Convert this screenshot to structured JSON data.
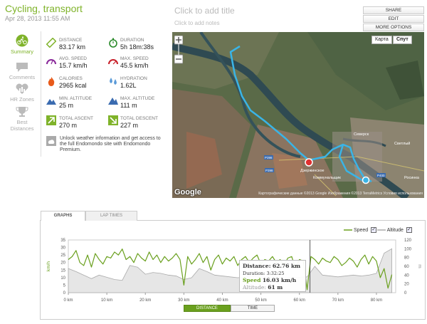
{
  "workout": {
    "title": "Cycling, transport",
    "date": "Apr 28, 2013 11:55 AM",
    "click_title": "Click to add title",
    "click_notes": "Click to add notes"
  },
  "actions": {
    "share": "SHARE",
    "edit": "EDIT",
    "more": "MORE OPTIONS"
  },
  "nav": {
    "summary": "Summary",
    "comments": "Comments",
    "hr_zones": "HR Zones",
    "best_line1": "Best",
    "best_line2": "Distances"
  },
  "stats": {
    "distance": {
      "label": "DISTANCE",
      "value": "83.17 km"
    },
    "duration": {
      "label": "DURATION",
      "value": "5h 18m:38s"
    },
    "avg_speed": {
      "label": "AVG. SPEED",
      "value": "15.7 km/h"
    },
    "max_speed": {
      "label": "MAX. SPEED",
      "value": "45.5 km/h"
    },
    "calories": {
      "label": "CALORIES",
      "value": "2965 kcal"
    },
    "hydration": {
      "label": "HYDRATION",
      "value": "1.62L"
    },
    "min_altitude": {
      "label": "MIN. ALTITUDE",
      "value": "25 m"
    },
    "max_altitude": {
      "label": "MAX. ALTITUDE",
      "value": "111 m"
    },
    "total_ascent": {
      "label": "TOTAL ASCENT",
      "value": "270 m"
    },
    "total_descent": {
      "label": "TOTAL DESCENT",
      "value": "227 m"
    }
  },
  "notice": "Unlock weather information and get access to the full Endomondo site with Endomondo Premium.",
  "map": {
    "map_btn": "Карта",
    "sat_btn": "Спут",
    "google": "Google",
    "attribution": "Картографические данные ©2013 Google Изображения ©2013 TerraMetrics Условия использования",
    "places": [
      "Дзержинское",
      "Коммунальщик",
      "Северск",
      "Светлый",
      "Росинка",
      "P398",
      "P400",
      "P398"
    ]
  },
  "graph_tabs": {
    "graphs": "GRAPHS",
    "lap_times": "LAP TIMES"
  },
  "legend": {
    "speed": "Speed",
    "altitude": "Altitude"
  },
  "toggle": {
    "distance": "DISTANCE",
    "time": "TIME"
  },
  "tooltip": {
    "distance_label": "Distance:",
    "distance_value": "62.76 km",
    "duration_label": "Duration:",
    "duration_value": "3:32:25",
    "speed_label": "Speed",
    "speed_value": "16.03 km/h",
    "altitude_label": "Altitude:",
    "altitude_value": "61 m"
  },
  "colors": {
    "accent": "#7fb32a",
    "speed": "#6aa01e",
    "altitude": "#aaaaaa",
    "route": "#3ab4e6"
  },
  "chart_data": {
    "type": "line",
    "ylabel_left": "km/h",
    "ylabel_right": "m",
    "xlim": [
      0,
      85
    ],
    "ylim_speed": [
      0,
      35
    ],
    "ylim_alt": [
      0,
      120
    ],
    "x_ticks": [
      "0 km",
      "10 km",
      "20 km",
      "30 km",
      "40 km",
      "50 km",
      "60 km",
      "70 km",
      "80 km"
    ],
    "y_ticks_left": [
      "0",
      "5",
      "10",
      "15",
      "20",
      "25",
      "30",
      "35"
    ],
    "y_ticks_right": [
      "0",
      "20",
      "40",
      "60",
      "80",
      "100",
      "120"
    ],
    "series": [
      {
        "name": "Speed",
        "x": [
          0,
          1,
          2,
          3,
          4,
          5,
          6,
          7,
          8,
          9,
          10,
          11,
          12,
          13,
          14,
          15,
          16,
          17,
          18,
          19,
          20,
          21,
          22,
          23,
          24,
          25,
          26,
          27,
          28,
          29,
          30,
          31,
          32,
          33,
          34,
          35,
          36,
          37,
          38,
          39,
          40,
          41,
          42,
          43,
          44,
          45,
          46,
          47,
          48,
          49,
          50,
          51,
          52,
          53,
          54,
          55,
          56,
          57,
          58,
          59,
          60,
          61,
          62,
          63,
          64,
          65,
          66,
          67,
          68,
          69,
          70,
          71,
          72,
          73,
          74,
          75,
          76,
          77,
          78,
          79,
          80,
          81,
          82,
          83,
          84
        ],
        "values": [
          22,
          24,
          28,
          20,
          18,
          25,
          17,
          26,
          22,
          19,
          24,
          23,
          27,
          25,
          29,
          22,
          24,
          20,
          26,
          23,
          21,
          27,
          22,
          25,
          20,
          24,
          21,
          23,
          26,
          22,
          5,
          24,
          19,
          22,
          26,
          20,
          24,
          15,
          22,
          25,
          19,
          23,
          21,
          24,
          18,
          22,
          24,
          20,
          23,
          25,
          19,
          22,
          21,
          24,
          20,
          22,
          18,
          23,
          24,
          16,
          22,
          21,
          2,
          24,
          22,
          19,
          23,
          21,
          20,
          24,
          22,
          18,
          20,
          23,
          21,
          17,
          22,
          25,
          19,
          24,
          21,
          10,
          16,
          3,
          12
        ]
      },
      {
        "name": "Altitude",
        "x": [
          0,
          2,
          4,
          6,
          8,
          10,
          12,
          14,
          16,
          18,
          20,
          22,
          24,
          26,
          28,
          30,
          32,
          34,
          36,
          38,
          40,
          42,
          44,
          46,
          48,
          50,
          52,
          54,
          56,
          58,
          60,
          62,
          64,
          66,
          68,
          70,
          72,
          74,
          76,
          78,
          80,
          82,
          84
        ],
        "values": [
          55,
          48,
          40,
          32,
          40,
          35,
          30,
          28,
          62,
          58,
          42,
          46,
          44,
          40,
          38,
          30,
          34,
          55,
          48,
          40,
          38,
          36,
          34,
          36,
          38,
          36,
          35,
          34,
          33,
          34,
          35,
          36,
          60,
          40,
          38,
          36,
          38,
          40,
          38,
          40,
          44,
          90,
          100
        ]
      }
    ]
  }
}
